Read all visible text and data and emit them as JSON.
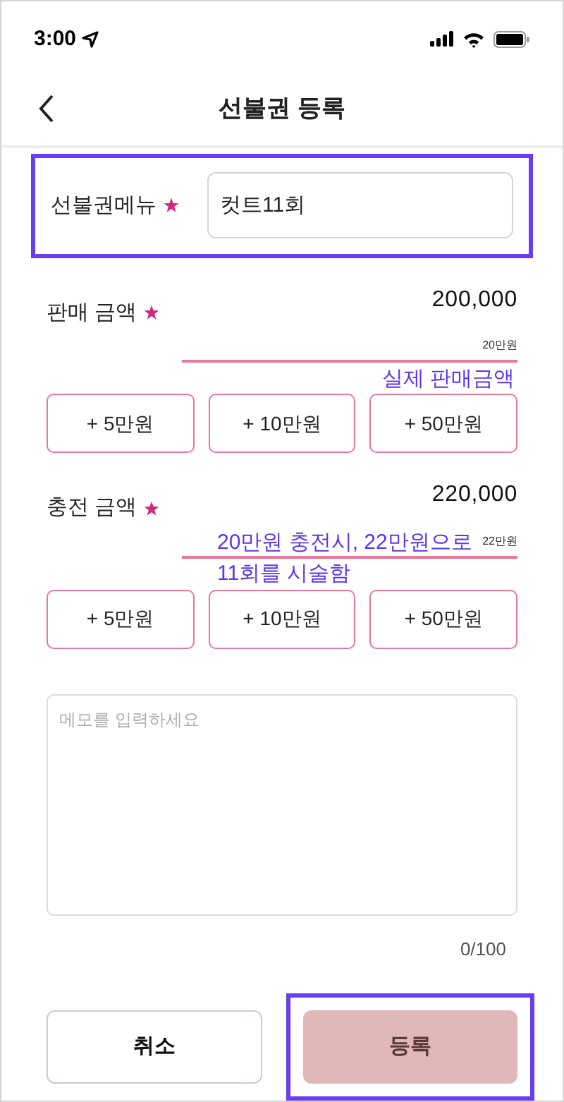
{
  "status_bar": {
    "time": "3:00"
  },
  "nav": {
    "title": "선불권 등록"
  },
  "menu_field": {
    "label": "선불권메뉴",
    "required": true,
    "value": "컷트11회",
    "highlighted": true
  },
  "amount_sections": [
    {
      "label": "판매 금액",
      "required": true,
      "value": "200,000",
      "unit_hint": "20만원",
      "note_below": "실제 판매금액",
      "buttons": [
        "+ 5만원",
        "+ 10만원",
        "+ 50만원"
      ]
    },
    {
      "label": "충전 금액",
      "required": true,
      "value": "220,000",
      "unit_hint": "22만원",
      "note_above": "20만원 충전시, 22만원으로",
      "note_below": "11회를 시술함",
      "buttons": [
        "+ 5만원",
        "+ 10만원",
        "+ 50만원"
      ]
    }
  ],
  "memo": {
    "placeholder": "메모를 입력하세요",
    "counter": "0/100"
  },
  "actions": [
    {
      "label": "취소",
      "kind": "secondary",
      "highlighted": false
    },
    {
      "label": "등록",
      "kind": "primary",
      "highlighted": true
    }
  ]
}
